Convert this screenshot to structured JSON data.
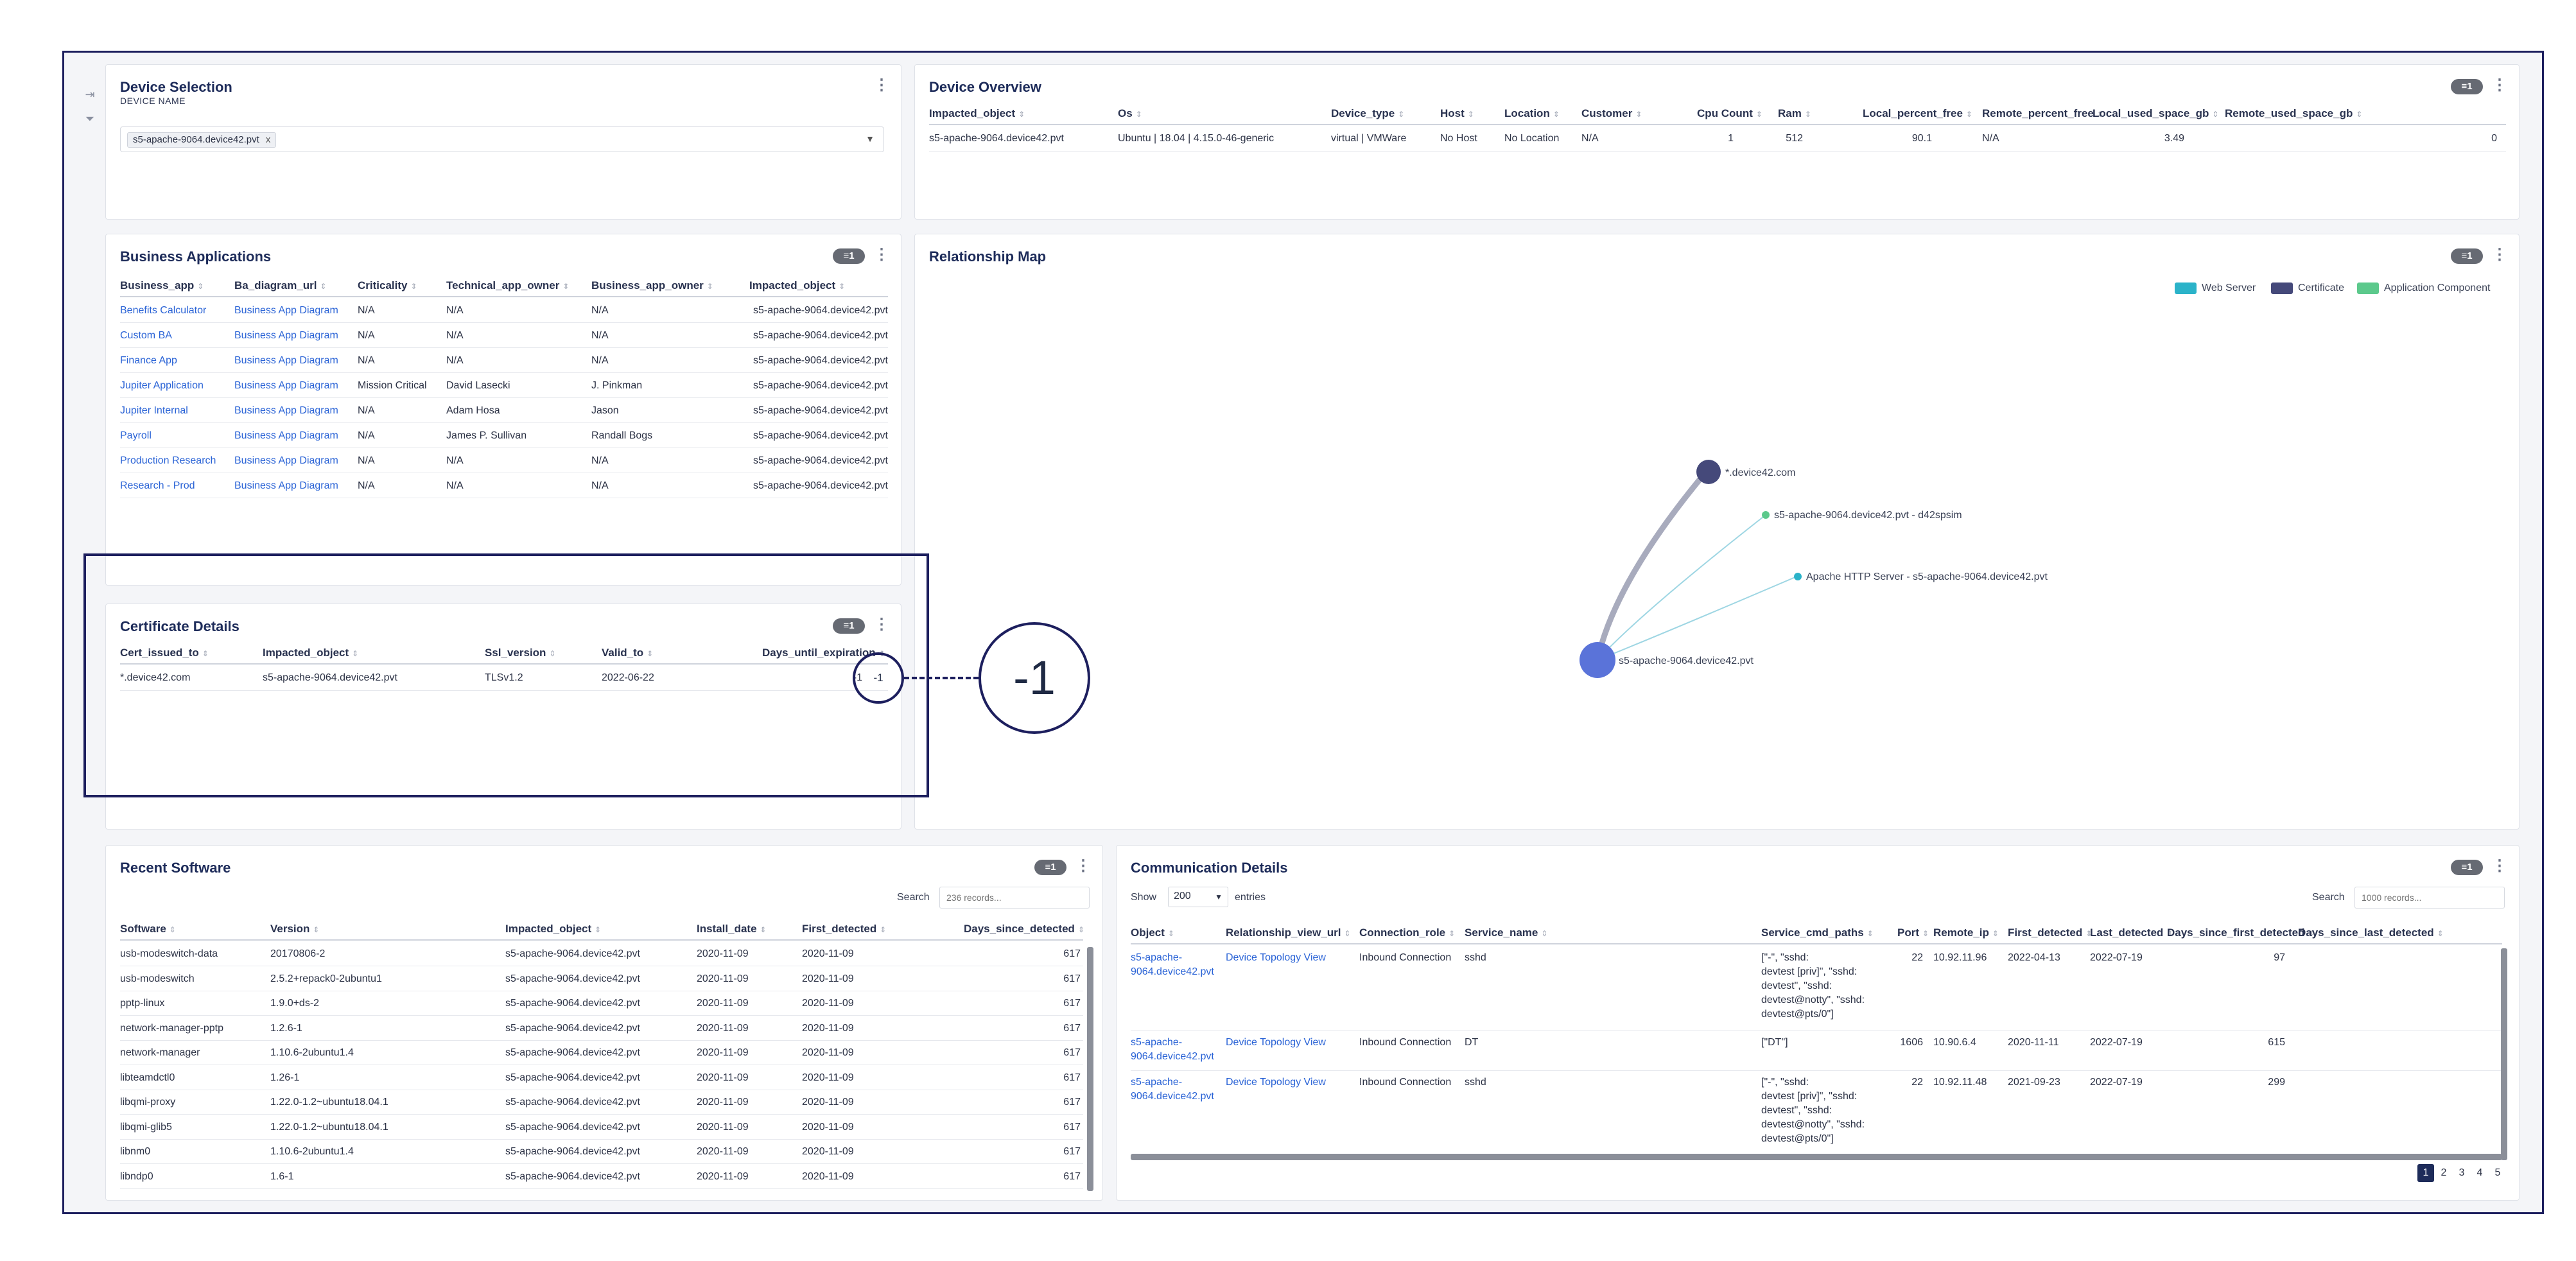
{
  "device_selection": {
    "title": "Device Selection",
    "label": "DEVICE NAME",
    "chip": "s5-apache-9064.device42.pvt",
    "chip_remove": "x",
    "dropdown_arrow": "▼"
  },
  "device_overview": {
    "title": "Device Overview",
    "badge": "≡1",
    "columns": [
      "Impacted_object",
      "Os",
      "Device_type",
      "Host",
      "Location",
      "Customer",
      "Cpu Count",
      "Ram",
      "Local_percent_free",
      "Remote_percent_free",
      "Local_used_space_gb",
      "Remote_used_space_gb"
    ],
    "row": [
      "s5-apache-9064.device42.pvt",
      "Ubuntu | 18.04 | 4.15.0-46-generic",
      "virtual | VMWare",
      "No Host",
      "No Location",
      "N/A",
      "1",
      "512",
      "90.1",
      "N/A",
      "3.49",
      "0"
    ]
  },
  "business_apps": {
    "title": "Business Applications",
    "badge": "≡1",
    "columns": [
      "Business_app",
      "Ba_diagram_url",
      "Criticality",
      "Technical_app_owner",
      "Business_app_owner",
      "Impacted_object"
    ],
    "rows": [
      [
        "Benefits Calculator",
        "Business App Diagram",
        "N/A",
        "N/A",
        "N/A",
        "s5-apache-9064.device42.pvt"
      ],
      [
        "Custom BA",
        "Business App Diagram",
        "N/A",
        "N/A",
        "N/A",
        "s5-apache-9064.device42.pvt"
      ],
      [
        "Finance App",
        "Business App Diagram",
        "N/A",
        "N/A",
        "N/A",
        "s5-apache-9064.device42.pvt"
      ],
      [
        "Jupiter Application",
        "Business App Diagram",
        "Mission Critical",
        "David Lasecki",
        "J. Pinkman",
        "s5-apache-9064.device42.pvt"
      ],
      [
        "Jupiter Internal",
        "Business App Diagram",
        "N/A",
        "Adam Hosa",
        "Jason",
        "s5-apache-9064.device42.pvt"
      ],
      [
        "Payroll",
        "Business App Diagram",
        "N/A",
        "James P. Sullivan",
        "Randall Bogs",
        "s5-apache-9064.device42.pvt"
      ],
      [
        "Production Research",
        "Business App Diagram",
        "N/A",
        "N/A",
        "N/A",
        "s5-apache-9064.device42.pvt"
      ],
      [
        "Research - Prod",
        "Business App Diagram",
        "N/A",
        "N/A",
        "N/A",
        "s5-apache-9064.device42.pvt"
      ]
    ]
  },
  "cert_details": {
    "title": "Certificate Details",
    "badge": "≡1",
    "columns": [
      "Cert_issued_to",
      "Impacted_object",
      "Ssl_version",
      "Valid_to",
      "Days_until_expiration"
    ],
    "row": [
      "*.device42.com",
      "s5-apache-9064.device42.pvt",
      "TLSv1.2",
      "2022-06-22",
      "-1"
    ]
  },
  "relationship_map": {
    "title": "Relationship Map",
    "badge": "≡1",
    "legend": [
      {
        "label": "Web Server",
        "color": "#2bb3c9"
      },
      {
        "label": "Certificate",
        "color": "#45497a"
      },
      {
        "label": "Application Component",
        "color": "#5cc98c"
      }
    ],
    "nodes": [
      {
        "label": "*.device42.com"
      },
      {
        "label": "s5-apache-9064.device42.pvt - d42spsim"
      },
      {
        "label": "Apache HTTP Server - s5-apache-9064.device42.pvt"
      },
      {
        "label": "s5-apache-9064.device42.pvt"
      }
    ]
  },
  "recent_software": {
    "title": "Recent Software",
    "badge": "≡1",
    "search_label": "Search",
    "search_placeholder": "236 records...",
    "columns": [
      "Software",
      "Version",
      "Impacted_object",
      "Install_date",
      "First_detected",
      "Days_since_detected"
    ],
    "rows": [
      [
        "usb-modeswitch-data",
        "20170806-2",
        "s5-apache-9064.device42.pvt",
        "2020-11-09",
        "2020-11-09",
        "617"
      ],
      [
        "usb-modeswitch",
        "2.5.2+repack0-2ubuntu1",
        "s5-apache-9064.device42.pvt",
        "2020-11-09",
        "2020-11-09",
        "617"
      ],
      [
        "pptp-linux",
        "1.9.0+ds-2",
        "s5-apache-9064.device42.pvt",
        "2020-11-09",
        "2020-11-09",
        "617"
      ],
      [
        "network-manager-pptp",
        "1.2.6-1",
        "s5-apache-9064.device42.pvt",
        "2020-11-09",
        "2020-11-09",
        "617"
      ],
      [
        "network-manager",
        "1.10.6-2ubuntu1.4",
        "s5-apache-9064.device42.pvt",
        "2020-11-09",
        "2020-11-09",
        "617"
      ],
      [
        "libteamdctl0",
        "1.26-1",
        "s5-apache-9064.device42.pvt",
        "2020-11-09",
        "2020-11-09",
        "617"
      ],
      [
        "libqmi-proxy",
        "1.22.0-1.2~ubuntu18.04.1",
        "s5-apache-9064.device42.pvt",
        "2020-11-09",
        "2020-11-09",
        "617"
      ],
      [
        "libqmi-glib5",
        "1.22.0-1.2~ubuntu18.04.1",
        "s5-apache-9064.device42.pvt",
        "2020-11-09",
        "2020-11-09",
        "617"
      ],
      [
        "libnm0",
        "1.10.6-2ubuntu1.4",
        "s5-apache-9064.device42.pvt",
        "2020-11-09",
        "2020-11-09",
        "617"
      ],
      [
        "libndp0",
        "1.6-1",
        "s5-apache-9064.device42.pvt",
        "2020-11-09",
        "2020-11-09",
        "617"
      ]
    ]
  },
  "comm_details": {
    "title": "Communication Details",
    "badge": "≡1",
    "show_label": "Show",
    "show_value": "200",
    "entries_label": "entries",
    "search_label": "Search",
    "search_placeholder": "1000 records...",
    "columns": [
      "Object",
      "Relationship_view_url",
      "Connection_role",
      "Service_name",
      "Service_cmd_paths",
      "Port",
      "Remote_ip",
      "First_detected",
      "Last_detected",
      "Days_since_first_detected",
      "Days_since_last_detected"
    ],
    "rows": [
      {
        "object": [
          "s5-apache-",
          "9064.device42.pvt"
        ],
        "url": "Device Topology View",
        "role": "Inbound Connection",
        "service": "sshd",
        "cmd": [
          "[\"-\", \"sshd:",
          "devtest [priv]\", \"sshd:",
          "devtest\", \"sshd:",
          "devtest@notty\", \"sshd:",
          "devtest@pts/0\"]"
        ],
        "port": "22",
        "ip": "10.92.11.96",
        "first": "2022-04-13",
        "last": "2022-07-19",
        "days_first": "97",
        "days_last": ""
      },
      {
        "object": [
          "s5-apache-",
          "9064.device42.pvt"
        ],
        "url": "Device Topology View",
        "role": "Inbound Connection",
        "service": "DT",
        "cmd": [
          "[\"DT\"]"
        ],
        "port": "1606",
        "ip": "10.90.6.4",
        "first": "2020-11-11",
        "last": "2022-07-19",
        "days_first": "615",
        "days_last": ""
      },
      {
        "object": [
          "s5-apache-",
          "9064.device42.pvt"
        ],
        "url": "Device Topology View",
        "role": "Inbound Connection",
        "service": "sshd",
        "cmd": [
          "[\"-\", \"sshd:",
          "devtest [priv]\", \"sshd:",
          "devtest\", \"sshd:",
          "devtest@notty\", \"sshd:",
          "devtest@pts/0\"]"
        ],
        "port": "22",
        "ip": "10.92.11.48",
        "first": "2021-09-23",
        "last": "2022-07-19",
        "days_first": "299",
        "days_last": ""
      }
    ],
    "pages": [
      "1",
      "2",
      "3",
      "4",
      "5"
    ]
  },
  "callout": {
    "small": "-1",
    "big": "-1"
  },
  "icons": {
    "collapse": "⇥",
    "filter": "⏷",
    "kebab": "⋮",
    "sort": "⇕"
  }
}
